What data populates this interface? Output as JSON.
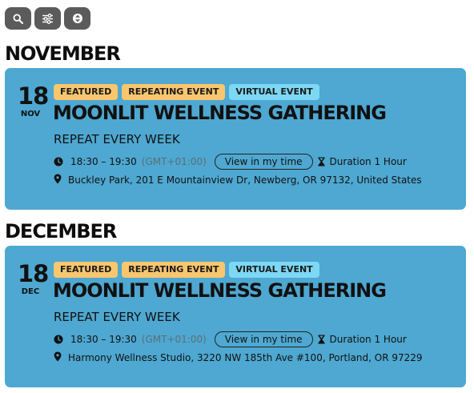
{
  "toolbar": {
    "buttons": [
      {
        "icon": "search-icon"
      },
      {
        "icon": "sliders-icon"
      },
      {
        "icon": "sort-icon"
      }
    ]
  },
  "groups": [
    {
      "month_heading": "NOVEMBER",
      "event": {
        "day": "18",
        "month_abbr": "NOV",
        "badges": [
          "FEATURED",
          "REPEATING EVENT",
          "VIRTUAL EVENT"
        ],
        "title": "MOONLIT WELLNESS GATHERING",
        "repeat": "REPEAT EVERY WEEK",
        "time_range": "18:30 – 19:30",
        "timezone": "(GMT+01:00)",
        "view_label": "View in my time",
        "duration": "Duration 1 Hour",
        "location": "Buckley Park, 201 E Mountainview Dr, Newberg, OR 97132, United States"
      }
    },
    {
      "month_heading": "DECEMBER",
      "event": {
        "day": "18",
        "month_abbr": "DEC",
        "badges": [
          "FEATURED",
          "REPEATING EVENT",
          "VIRTUAL EVENT"
        ],
        "title": "MOONLIT WELLNESS GATHERING",
        "repeat": "REPEAT EVERY WEEK",
        "time_range": "18:30 – 19:30",
        "timezone": "(GMT+01:00)",
        "view_label": "View in my time",
        "duration": "Duration 1 Hour",
        "location": "Harmony Wellness Studio, 3220 NW 185th Ave #100, Portland, OR 97229"
      }
    }
  ],
  "colors": {
    "card_background": "#4ea8d1",
    "badge_yellow": "#f9c66e",
    "badge_cyan": "#7cd8f4",
    "toolbar_button": "#5b5b5b"
  }
}
